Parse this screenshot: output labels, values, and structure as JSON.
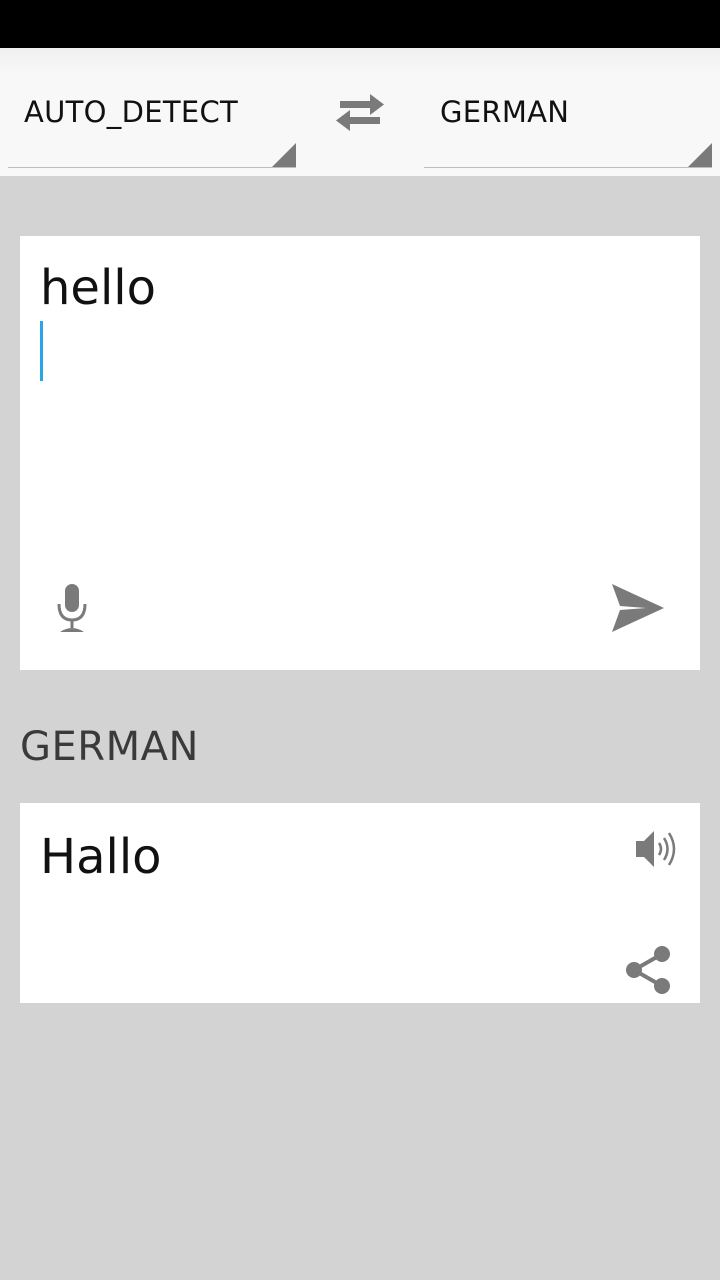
{
  "language_bar": {
    "source_language": "AUTO_DETECT",
    "target_language": "GERMAN",
    "swap_icon": "swap-arrows-icon"
  },
  "input": {
    "text": "hello",
    "mic_icon": "microphone-icon",
    "send_icon": "send-icon"
  },
  "output": {
    "language_heading": "GERMAN",
    "text": "Hallo",
    "speaker_icon": "speaker-icon",
    "share_icon": "share-icon"
  },
  "colors": {
    "background": "#d3d3d3",
    "card": "#ffffff",
    "cursor": "#2aa6e8",
    "icon": "#7a7a7a"
  }
}
